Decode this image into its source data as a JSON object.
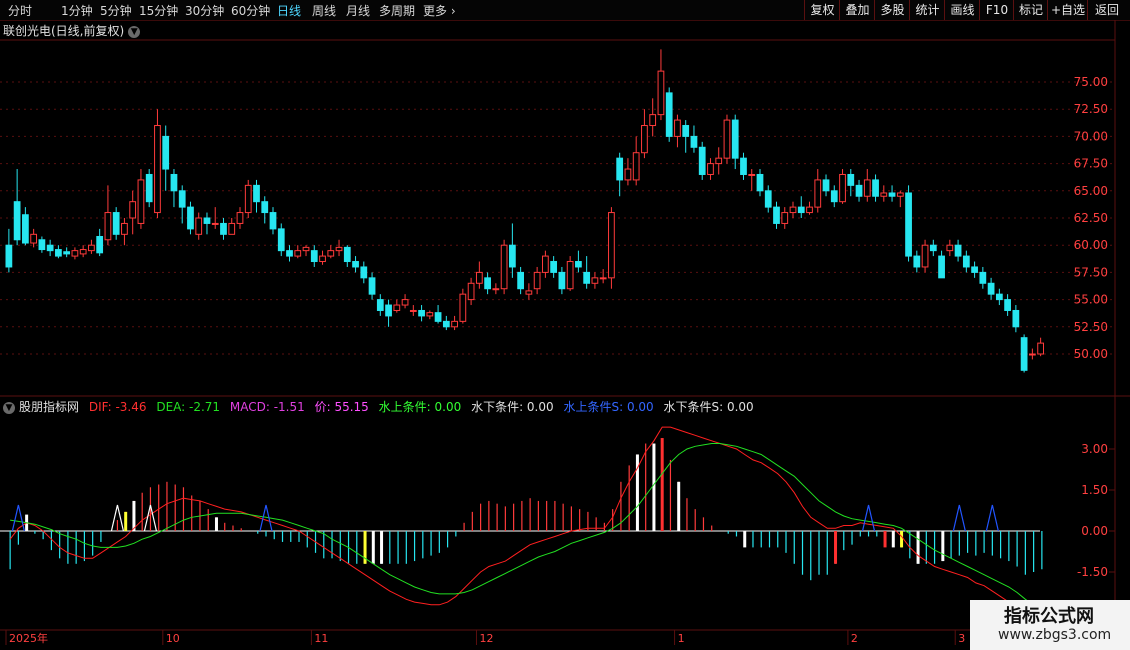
{
  "topbar": {
    "periods": [
      "分时",
      "1分钟",
      "5分钟",
      "15分钟",
      "30分钟",
      "60分钟",
      "日线",
      "周线",
      "月线",
      "多周期",
      "更多"
    ],
    "active_period": "日线",
    "right_buttons": [
      "复权",
      "叠加",
      "多股",
      "统计",
      "画线",
      "F10",
      "标记",
      "+自选",
      "返回"
    ]
  },
  "chart": {
    "title": "联创光电(日线,前复权)",
    "price_ticks": [
      "75.00",
      "72.50",
      "70.00",
      "67.50",
      "65.00",
      "62.50",
      "60.00",
      "57.50",
      "55.00",
      "52.50",
      "50.00"
    ],
    "macd_ticks": [
      "3.00",
      "1.50",
      "0.00",
      "-1.50"
    ],
    "date_labels": [
      "2025年",
      "10",
      "11",
      "12",
      "1",
      "2",
      "3"
    ],
    "colors": {
      "up": "#ff3b3b",
      "down": "#27e6f0",
      "dif": "#ff2020",
      "dea": "#22e022",
      "macd": "#e040e0",
      "grid": "#5a0f0f"
    }
  },
  "indicator": {
    "name": "股朋指标网",
    "dif_label": "DIF: -3.46",
    "dea_label": "DEA: -2.71",
    "macd_label": "MACD: -1.51",
    "price_label": "价: 55.15",
    "c1_label": "水上条件: 0.00",
    "c2_label": "水下条件: 0.00",
    "c3_label": "水上条件S: 0.00",
    "c4_label": "水下条件S: 0.00"
  },
  "watermark": {
    "title": "指标公式网",
    "url": "www.zbgs3.com"
  },
  "chart_data": {
    "type": "candlestick",
    "ylim": [
      48.0,
      80.0
    ],
    "candles": [
      [
        60.0,
        58.0,
        61.5,
        57.5
      ],
      [
        64.0,
        60.5,
        67.0,
        60.0
      ],
      [
        62.8,
        60.2,
        63.5,
        60.0
      ],
      [
        60.2,
        61.0,
        61.5,
        59.8
      ],
      [
        60.5,
        59.6,
        60.8,
        59.3
      ],
      [
        60.0,
        59.5,
        60.5,
        59.0
      ],
      [
        59.6,
        59.0,
        60.0,
        58.8
      ],
      [
        59.4,
        59.2,
        59.8,
        58.9
      ],
      [
        59.0,
        59.5,
        59.8,
        58.7
      ],
      [
        59.2,
        59.6,
        60.0,
        58.9
      ],
      [
        59.5,
        60.0,
        60.5,
        59.2
      ],
      [
        60.8,
        59.3,
        61.5,
        59.0
      ],
      [
        60.5,
        63.0,
        65.5,
        60.0
      ],
      [
        63.0,
        61.0,
        63.5,
        60.5
      ],
      [
        61.0,
        62.0,
        62.5,
        60.0
      ],
      [
        62.5,
        64.0,
        65.0,
        61.0
      ],
      [
        62.0,
        66.0,
        67.0,
        61.5
      ],
      [
        66.5,
        64.0,
        67.0,
        63.5
      ],
      [
        63.0,
        71.0,
        72.5,
        62.5
      ],
      [
        70.0,
        67.0,
        71.0,
        65.0
      ],
      [
        66.5,
        65.0,
        67.0,
        63.5
      ],
      [
        65.0,
        63.5,
        65.5,
        62.0
      ],
      [
        63.5,
        61.5,
        64.0,
        61.0
      ],
      [
        61.0,
        62.5,
        63.0,
        60.5
      ],
      [
        62.5,
        62.0,
        63.0,
        61.0
      ],
      [
        62.0,
        62.0,
        63.5,
        61.5
      ],
      [
        62.0,
        61.0,
        62.5,
        60.5
      ],
      [
        61.0,
        62.0,
        62.5,
        61.0
      ],
      [
        62.0,
        63.0,
        63.5,
        61.5
      ],
      [
        63.0,
        65.5,
        66.0,
        62.5
      ],
      [
        65.5,
        64.0,
        66.0,
        63.0
      ],
      [
        64.0,
        63.0,
        64.5,
        62.0
      ],
      [
        63.0,
        61.5,
        63.5,
        61.0
      ],
      [
        61.5,
        59.5,
        62.0,
        59.0
      ],
      [
        59.5,
        59.0,
        60.0,
        58.5
      ],
      [
        59.0,
        59.5,
        60.0,
        58.8
      ],
      [
        59.5,
        59.8,
        60.0,
        59.0
      ],
      [
        59.5,
        58.5,
        60.0,
        58.0
      ],
      [
        58.5,
        59.0,
        59.5,
        58.2
      ],
      [
        59.0,
        59.5,
        60.0,
        58.8
      ],
      [
        59.5,
        59.8,
        60.5,
        59.0
      ],
      [
        59.8,
        58.5,
        60.0,
        58.0
      ],
      [
        58.5,
        58.0,
        59.0,
        57.5
      ],
      [
        58.0,
        57.0,
        58.5,
        56.5
      ],
      [
        57.0,
        55.5,
        57.5,
        55.0
      ],
      [
        55.0,
        54.0,
        55.5,
        53.5
      ],
      [
        54.5,
        53.5,
        55.0,
        52.5
      ],
      [
        54.0,
        54.5,
        55.0,
        53.8
      ],
      [
        54.5,
        55.0,
        55.5,
        54.2
      ],
      [
        54.0,
        54.0,
        54.5,
        53.5
      ],
      [
        54.0,
        53.5,
        54.5,
        53.0
      ],
      [
        53.5,
        53.8,
        54.0,
        53.2
      ],
      [
        53.8,
        53.0,
        54.5,
        52.8
      ],
      [
        53.0,
        52.5,
        53.5,
        52.2
      ],
      [
        52.5,
        53.0,
        53.5,
        52.2
      ],
      [
        53.0,
        55.5,
        56.0,
        52.8
      ],
      [
        55.0,
        56.5,
        57.0,
        54.5
      ],
      [
        56.5,
        57.5,
        58.5,
        56.0
      ],
      [
        57.0,
        56.0,
        57.5,
        55.5
      ],
      [
        56.0,
        56.0,
        56.5,
        55.5
      ],
      [
        56.0,
        60.0,
        60.5,
        55.5
      ],
      [
        60.0,
        58.0,
        62.0,
        57.0
      ],
      [
        57.5,
        56.0,
        58.0,
        55.5
      ],
      [
        55.5,
        55.8,
        56.5,
        55.0
      ],
      [
        56.0,
        57.5,
        58.0,
        55.5
      ],
      [
        57.5,
        59.0,
        59.5,
        57.0
      ],
      [
        58.5,
        57.5,
        59.0,
        57.0
      ],
      [
        57.5,
        56.0,
        58.0,
        55.5
      ],
      [
        56.0,
        58.5,
        59.0,
        55.8
      ],
      [
        58.5,
        58.0,
        59.5,
        57.5
      ],
      [
        57.5,
        56.5,
        59.0,
        56.0
      ],
      [
        56.5,
        57.0,
        57.5,
        56.0
      ],
      [
        57.0,
        57.0,
        57.8,
        56.5
      ],
      [
        57.0,
        63.0,
        63.5,
        56.0
      ],
      [
        68.0,
        66.0,
        68.5,
        64.5
      ],
      [
        66.0,
        67.0,
        68.0,
        65.5
      ],
      [
        66.0,
        68.5,
        70.0,
        65.5
      ],
      [
        68.5,
        71.0,
        72.5,
        68.0
      ],
      [
        71.0,
        72.0,
        73.5,
        70.0
      ],
      [
        72.0,
        76.0,
        78.0,
        71.5
      ],
      [
        74.0,
        70.0,
        74.5,
        69.5
      ],
      [
        70.0,
        71.5,
        72.0,
        69.0
      ],
      [
        71.0,
        70.0,
        71.5,
        68.5
      ],
      [
        70.0,
        69.0,
        71.0,
        68.5
      ],
      [
        69.0,
        66.5,
        69.5,
        66.0
      ],
      [
        66.5,
        67.5,
        68.0,
        66.0
      ],
      [
        67.5,
        68.0,
        69.0,
        66.5
      ],
      [
        68.0,
        71.5,
        72.0,
        67.5
      ],
      [
        71.5,
        68.0,
        72.0,
        67.0
      ],
      [
        68.0,
        66.5,
        68.5,
        66.0
      ],
      [
        66.5,
        66.5,
        67.0,
        65.0
      ],
      [
        66.5,
        65.0,
        67.0,
        64.5
      ],
      [
        65.0,
        63.5,
        65.5,
        63.0
      ],
      [
        63.5,
        62.0,
        64.0,
        61.5
      ],
      [
        62.0,
        63.0,
        63.5,
        61.5
      ],
      [
        63.0,
        63.5,
        64.0,
        62.5
      ],
      [
        63.5,
        63.0,
        64.5,
        62.5
      ],
      [
        63.0,
        63.5,
        64.0,
        62.8
      ],
      [
        63.5,
        66.0,
        67.0,
        63.0
      ],
      [
        66.0,
        65.0,
        66.5,
        64.5
      ],
      [
        65.0,
        64.0,
        65.5,
        63.5
      ],
      [
        64.0,
        66.5,
        67.0,
        63.8
      ],
      [
        66.5,
        65.5,
        67.0,
        64.5
      ],
      [
        65.5,
        64.5,
        66.0,
        64.0
      ],
      [
        64.5,
        66.0,
        67.0,
        64.0
      ],
      [
        66.0,
        64.5,
        66.5,
        64.0
      ],
      [
        64.5,
        64.8,
        65.5,
        64.0
      ],
      [
        64.8,
        64.5,
        65.5,
        64.0
      ],
      [
        64.5,
        64.8,
        65.0,
        63.5
      ],
      [
        64.8,
        59.0,
        65.5,
        58.5
      ],
      [
        59.0,
        58.0,
        59.5,
        57.5
      ],
      [
        58.0,
        60.0,
        60.5,
        57.5
      ],
      [
        60.0,
        59.5,
        60.5,
        59.0
      ],
      [
        59.0,
        57.0,
        59.5,
        57.0
      ],
      [
        59.5,
        60.0,
        60.5,
        59.0
      ],
      [
        60.0,
        59.0,
        60.5,
        58.5
      ],
      [
        59.0,
        58.0,
        59.5,
        57.5
      ],
      [
        58.0,
        57.5,
        58.5,
        57.0
      ],
      [
        57.5,
        56.5,
        58.0,
        56.0
      ],
      [
        56.5,
        55.5,
        57.0,
        55.0
      ],
      [
        55.5,
        55.0,
        56.0,
        54.5
      ],
      [
        55.0,
        54.0,
        55.5,
        53.5
      ],
      [
        54.0,
        52.5,
        54.5,
        52.0
      ],
      [
        51.5,
        48.5,
        51.8,
        48.3
      ],
      [
        50.0,
        50.0,
        50.5,
        49.5
      ],
      [
        50.0,
        51.0,
        51.5,
        49.8
      ]
    ],
    "dif": [
      -0.3,
      0.1,
      0.3,
      0.2,
      0.0,
      -0.3,
      -0.6,
      -0.8,
      -0.9,
      -1.0,
      -1.0,
      -0.8,
      -0.6,
      -0.4,
      -0.2,
      0.1,
      0.4,
      0.6,
      0.8,
      1.0,
      1.1,
      1.2,
      1.15,
      1.1,
      1.0,
      0.9,
      0.8,
      0.75,
      0.7,
      0.6,
      0.5,
      0.4,
      0.3,
      0.2,
      0.1,
      0.0,
      -0.2,
      -0.4,
      -0.6,
      -0.8,
      -1.0,
      -1.2,
      -1.4,
      -1.6,
      -1.8,
      -2.0,
      -2.2,
      -2.35,
      -2.5,
      -2.6,
      -2.65,
      -2.7,
      -2.7,
      -2.6,
      -2.4,
      -2.1,
      -1.8,
      -1.5,
      -1.3,
      -1.2,
      -1.1,
      -0.9,
      -0.7,
      -0.5,
      -0.4,
      -0.3,
      -0.2,
      -0.1,
      0.0,
      0.05,
      0.1,
      0.1,
      0.1,
      0.5,
      1.2,
      1.8,
      2.3,
      2.9,
      3.3,
      3.8,
      3.8,
      3.7,
      3.6,
      3.5,
      3.4,
      3.3,
      3.2,
      3.1,
      3.0,
      2.8,
      2.6,
      2.5,
      2.3,
      2.1,
      1.8,
      1.4,
      0.9,
      0.5,
      0.3,
      0.1,
      0.1,
      0.2,
      0.2,
      0.3,
      0.25,
      0.2,
      0.15,
      0.1,
      -0.2,
      -0.6,
      -0.9,
      -1.1,
      -1.3,
      -1.4,
      -1.5,
      -1.6,
      -1.7,
      -1.9,
      -2.0,
      -2.2,
      -2.4,
      -2.6,
      -2.9,
      -3.3,
      -3.46,
      -3.5
    ],
    "dea": [
      0.4,
      0.35,
      0.3,
      0.25,
      0.15,
      0.05,
      -0.1,
      -0.2,
      -0.3,
      -0.45,
      -0.55,
      -0.6,
      -0.6,
      -0.6,
      -0.55,
      -0.45,
      -0.3,
      -0.2,
      -0.05,
      0.1,
      0.25,
      0.4,
      0.5,
      0.55,
      0.6,
      0.65,
      0.65,
      0.65,
      0.65,
      0.6,
      0.55,
      0.5,
      0.45,
      0.4,
      0.3,
      0.2,
      0.1,
      0.0,
      -0.1,
      -0.3,
      -0.45,
      -0.6,
      -0.8,
      -1.0,
      -1.2,
      -1.4,
      -1.6,
      -1.75,
      -1.9,
      -2.05,
      -2.15,
      -2.25,
      -2.3,
      -2.3,
      -2.3,
      -2.25,
      -2.15,
      -2.0,
      -1.85,
      -1.7,
      -1.55,
      -1.4,
      -1.25,
      -1.1,
      -0.95,
      -0.85,
      -0.75,
      -0.6,
      -0.45,
      -0.35,
      -0.25,
      -0.15,
      -0.05,
      0.1,
      0.3,
      0.6,
      0.9,
      1.3,
      1.7,
      2.1,
      2.5,
      2.8,
      3.0,
      3.1,
      3.15,
      3.2,
      3.2,
      3.15,
      3.1,
      3.0,
      2.9,
      2.8,
      2.6,
      2.4,
      2.2,
      2.0,
      1.7,
      1.4,
      1.1,
      0.9,
      0.7,
      0.55,
      0.45,
      0.4,
      0.35,
      0.3,
      0.25,
      0.2,
      0.1,
      -0.1,
      -0.3,
      -0.5,
      -0.7,
      -0.85,
      -1.0,
      -1.15,
      -1.3,
      -1.45,
      -1.6,
      -1.75,
      -1.9,
      -2.05,
      -2.25,
      -2.5,
      -2.71,
      -2.8
    ]
  }
}
